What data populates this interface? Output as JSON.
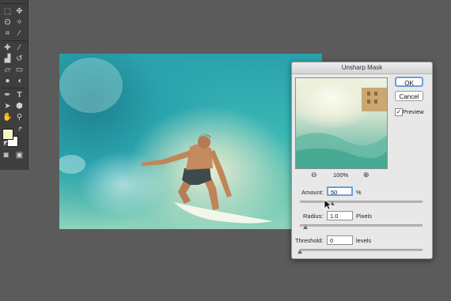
{
  "dialog": {
    "title": "Unsharp Mask",
    "ok_label": "OK",
    "cancel_label": "Cancel",
    "preview_label": "Preview",
    "preview_checked": true,
    "zoom": "100%",
    "amount": {
      "label": "Amount:",
      "value": "50",
      "unit": "%",
      "fraction": 0.1
    },
    "radius": {
      "label": "Radius:",
      "value": "1.0",
      "unit": "Pixels",
      "fraction": 0.0
    },
    "threshold": {
      "label": "Threshold:",
      "value": "0",
      "unit": "levels",
      "fraction": 0.0
    }
  },
  "tools": {
    "icons": [
      "marquee-icon",
      "move-icon",
      "lasso-icon",
      "magic-wand-icon",
      "crop-icon",
      "eyedropper-icon",
      "healing-brush-icon",
      "brush-icon",
      "stamp-icon",
      "history-brush-icon",
      "eraser-icon",
      "gradient-icon",
      "blur-icon",
      "dodge-icon",
      "pen-icon",
      "type-icon",
      "path-selection-icon",
      "shape-icon",
      "hand-icon",
      "zoom-icon"
    ],
    "foreground_color": "#f5f2c4",
    "background_color": "#ffffff"
  },
  "canvas": {
    "content": "surfer-photo"
  }
}
